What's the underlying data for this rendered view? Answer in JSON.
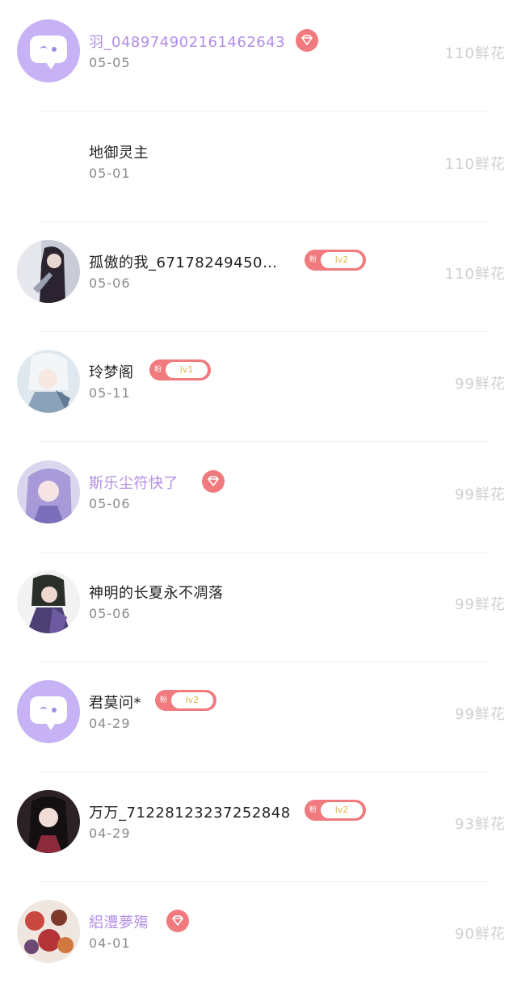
{
  "colors": {
    "vip_name": "#b28ee6",
    "badge": "#f07a7e",
    "default_avatar": "#c7b2f5",
    "flowers": "#cfcfcf"
  },
  "items": [
    {
      "name": "羽_048974902161462643",
      "date": "05-05",
      "flowers": "110鲜花",
      "badge": "vip",
      "avatar": "default-avatar"
    },
    {
      "name": "地御灵主",
      "date": "05-01",
      "flowers": "110鲜花",
      "badge": "",
      "avatar": "none"
    },
    {
      "name": "孤傲的我_67178249450…",
      "date": "05-06",
      "flowers": "110鲜花",
      "badge": "lv",
      "lv": "lv2",
      "fan": "粉",
      "avatar": "photo-avatar"
    },
    {
      "name": "玲梦阁",
      "date": "05-11",
      "flowers": "99鲜花",
      "badge": "lv",
      "lv": "lv1",
      "fan": "粉",
      "avatar": "photo-avatar"
    },
    {
      "name": "斯乐尘符快了",
      "date": "05-06",
      "flowers": "99鲜花",
      "badge": "vip",
      "avatar": "photo-avatar"
    },
    {
      "name": "神明的长夏永不凋落",
      "date": "05-06",
      "flowers": "99鲜花",
      "badge": "",
      "avatar": "photo-avatar"
    },
    {
      "name": "君莫问*",
      "date": "04-29",
      "flowers": "99鲜花",
      "badge": "lv",
      "lv": "lv2",
      "fan": "粉",
      "avatar": "default-avatar"
    },
    {
      "name": "万万_71228123237252848",
      "date": "04-29",
      "flowers": "93鲜花",
      "badge": "lv",
      "lv": "lv2",
      "fan": "粉",
      "avatar": "photo-avatar"
    },
    {
      "name": "絽澧夢殤",
      "date": "04-01",
      "flowers": "90鲜花",
      "badge": "vip",
      "avatar": "photo-avatar"
    }
  ]
}
